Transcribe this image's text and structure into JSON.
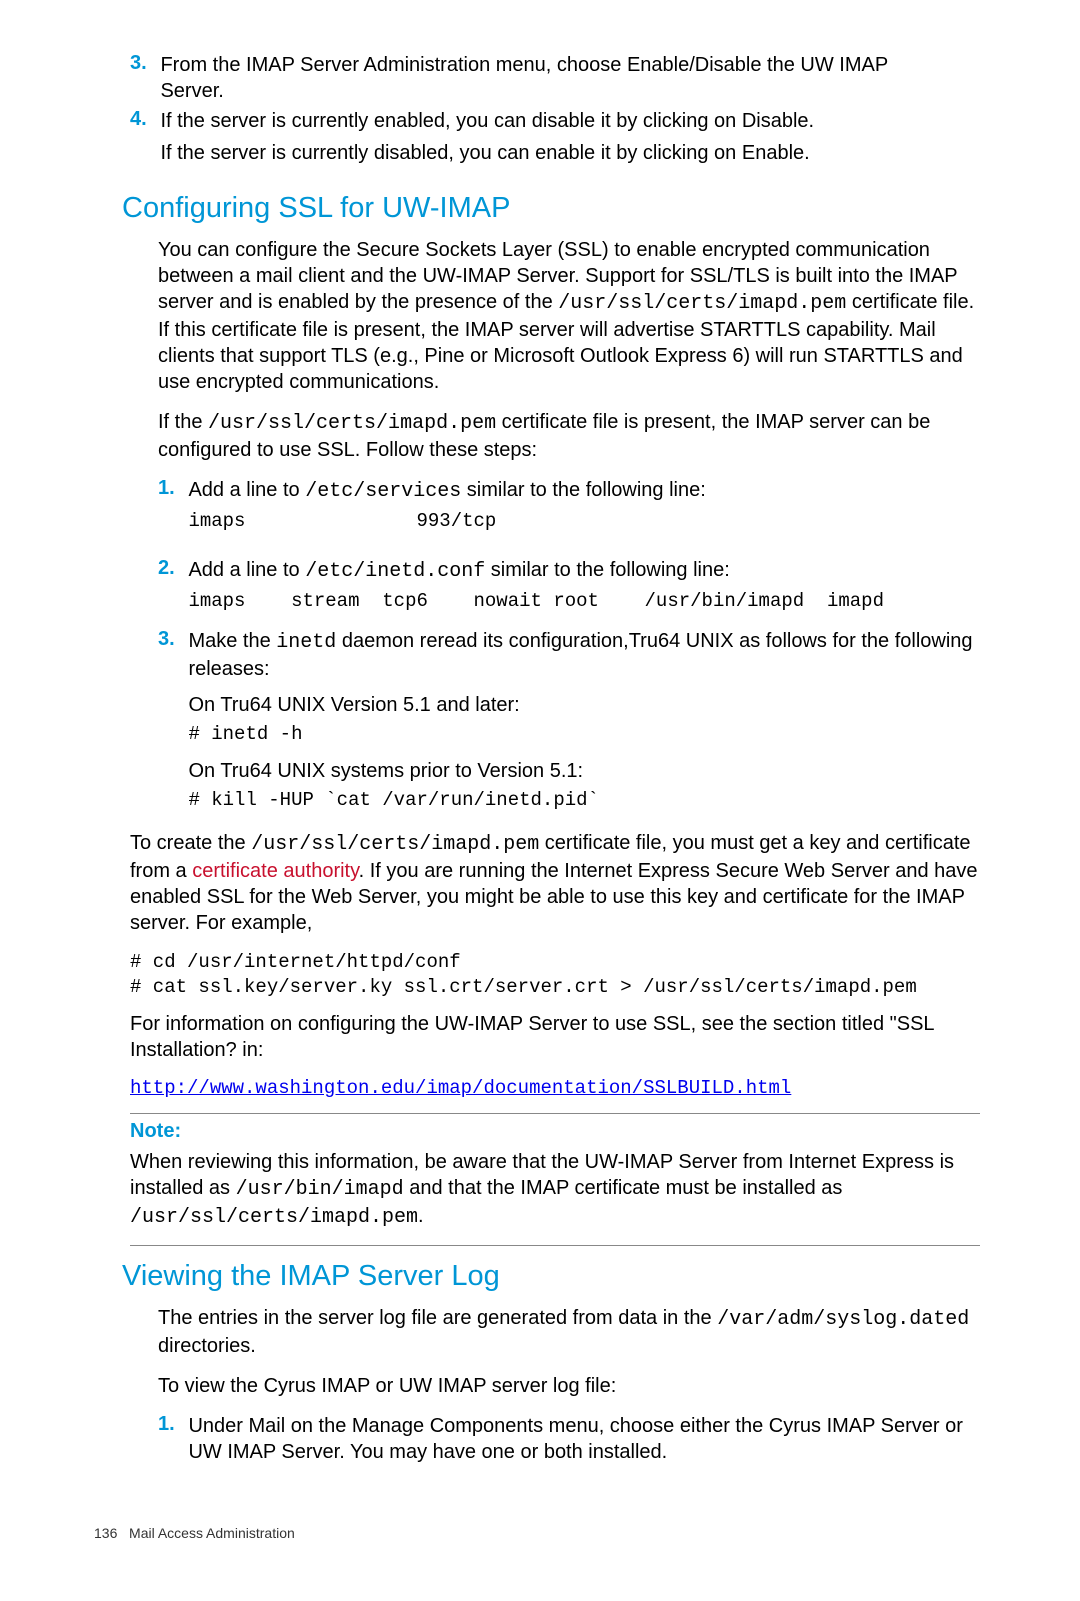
{
  "top_list": {
    "n3": "3.",
    "t3": "From the IMAP Server Administration menu, choose Enable/Disable the UW IMAP Server.",
    "n4": "4.",
    "t4a": "If the server is currently enabled, you can disable it by clicking on Disable.",
    "t4b": "If the server is currently disabled, you can enable it by clicking on Enable."
  },
  "sec_ssl": {
    "title": "Configuring SSL for UW-IMAP",
    "p1a": "You can configure the Secure Sockets Layer (SSL) to enable encrypted communication between a mail client and the UW-IMAP Server. Support for SSL/TLS is built into the IMAP server and is enabled by the presence of the ",
    "p1b": "/usr/ssl/certs/imapd.pem",
    "p1c": " certificate file. If this certificate file is present, the IMAP server will advertise STARTTLS capability. Mail clients that support TLS (e.g., Pine or Microsoft Outlook Express 6) will run STARTTLS and use encrypted communications.",
    "p2a": "If the ",
    "p2b": "/usr/ssl/certs/imapd.pem",
    "p2c": " certificate file is present, the IMAP server can be configured to use SSL. Follow these steps:",
    "li1n": "1.",
    "li1a": "Add a line to ",
    "li1b": "/etc/services",
    "li1c": " similar to the following line:",
    "li1code": "imaps               993/tcp",
    "li2n": "2.",
    "li2a": "Add a line to ",
    "li2b": "/etc/inetd.conf",
    "li2c": " similar to the following line:",
    "li2code": "imaps    stream  tcp6    nowait root    /usr/bin/imapd  imapd",
    "li3n": "3.",
    "li3a": "Make the ",
    "li3b": "inetd",
    "li3c": " daemon reread its configuration,Tru64 UNIX as follows for the following releases:",
    "li3p1": "On Tru64 UNIX Version 5.1 and later:",
    "li3code1": "# inetd -h",
    "li3p2": "On Tru64 UNIX systems prior to Version 5.1:",
    "li3code2": "# kill -HUP `cat /var/run/inetd.pid`",
    "p3a": "To create the ",
    "p3b": "/usr/ssl/certs/imapd.pem",
    "p3c": " certificate file, you must get a key and certificate from a ",
    "p3d": "certificate authority",
    "p3e": ". If you are running the Internet Express Secure Web Server and have enabled SSL for the Web Server, you might be able to use this key and certificate for the IMAP server. For example,",
    "code2": "# cd /usr/internet/httpd/conf\n# cat ssl.key/server.ky ssl.crt/server.crt > /usr/ssl/certs/imapd.pem",
    "p4": "For information on configuring the UW-IMAP Server to use SSL, see the section titled \"SSL Installation? in:",
    "url": "http://www.washington.edu/imap/documentation/SSLBUILD.html",
    "note_label": "Note:",
    "note_a": "When reviewing this information, be aware that the UW-IMAP Server from Internet Express is installed as ",
    "note_b": "/usr/bin/imapd",
    "note_c": " and that the IMAP certificate must be installed as ",
    "note_d": "/usr/ssl/certs/imapd.pem",
    "note_e": "."
  },
  "sec_log": {
    "title": "Viewing the IMAP Server Log",
    "p1a": "The entries in the server log file are generated from data in the ",
    "p1b": "/var/adm/syslog.dated",
    "p1c": " directories.",
    "p2": "To view the Cyrus IMAP or UW IMAP server log file:",
    "li1n": "1.",
    "li1": "Under Mail on the Manage Components menu, choose either the Cyrus IMAP Server or UW IMAP Server. You may have one or both installed."
  },
  "footer": {
    "page": "136",
    "chapter": "Mail Access Administration"
  }
}
